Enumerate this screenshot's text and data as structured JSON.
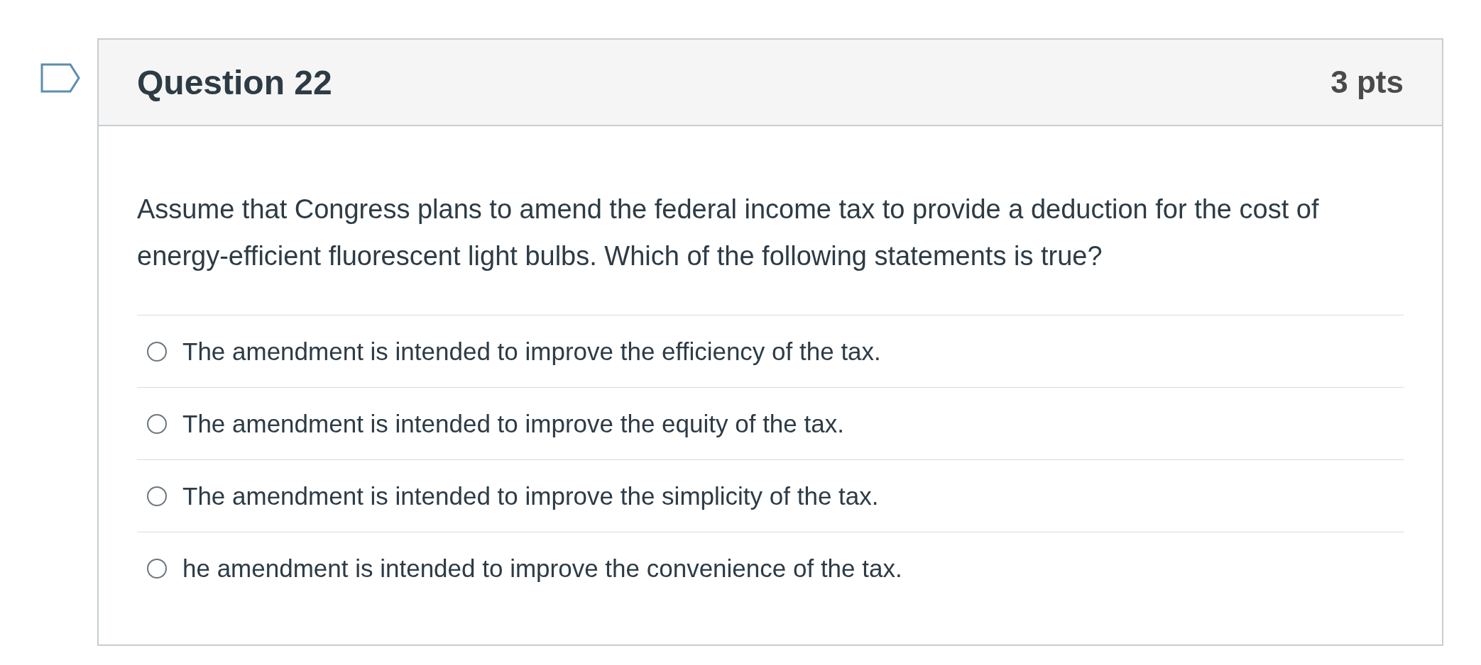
{
  "question": {
    "title": "Question 22",
    "points": "3 pts",
    "text": "Assume that Congress plans to amend the federal income tax to provide a deduction for the cost of energy-efficient fluorescent light bulbs. Which of the following statements is true?"
  },
  "options": [
    {
      "label": "The amendment is intended to improve the efficiency of the tax.",
      "selected": false
    },
    {
      "label": "The amendment is intended to improve the equity of the tax.",
      "selected": false
    },
    {
      "label": "The amendment is intended to improve the simplicity of the tax.",
      "selected": false
    },
    {
      "label": "he amendment is intended to improve the convenience of the tax.",
      "selected": false
    }
  ]
}
